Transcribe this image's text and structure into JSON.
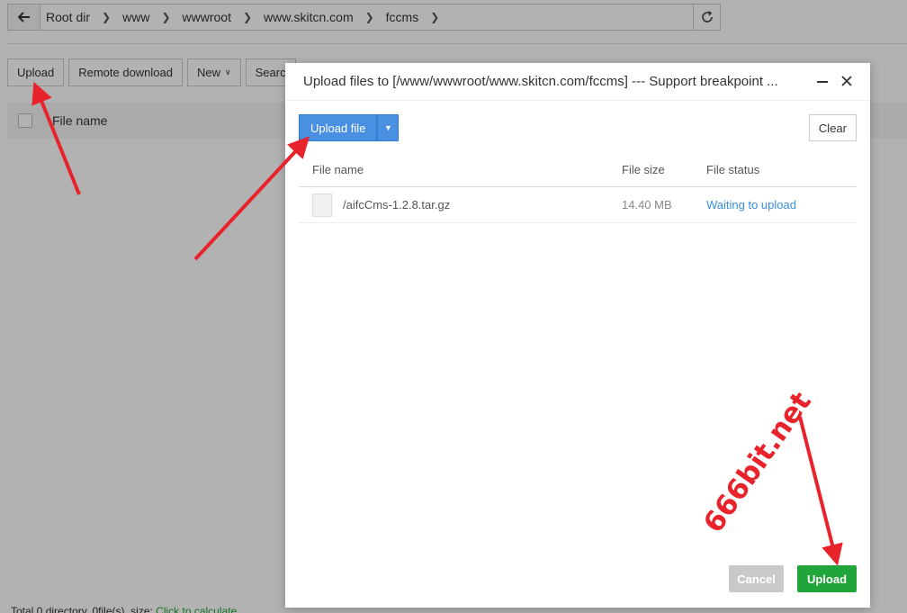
{
  "pathbar": {
    "crumbs": [
      "Root dir",
      "www",
      "wwwroot",
      "www.skitcn.com",
      "fccms"
    ]
  },
  "toolbar": {
    "upload": "Upload",
    "remote_download": "Remote download",
    "new": "New",
    "search": "Searc"
  },
  "table": {
    "col_filename": "File name"
  },
  "footer": {
    "summary": "Total 0 directory, 0file(s), size:",
    "calc_link": "Click to calculate"
  },
  "modal": {
    "title": "Upload files to [/www/wwwroot/www.skitcn.com/fccms] --- Support breakpoint ...",
    "upload_file": "Upload file",
    "clear": "Clear",
    "headers": {
      "name": "File name",
      "size": "File size",
      "status": "File status"
    },
    "files": [
      {
        "name": "/aifcCms-1.2.8.tar.gz",
        "size": "14.40 MB",
        "status": "Waiting to upload"
      }
    ],
    "cancel": "Cancel",
    "upload": "Upload"
  },
  "watermark": "666bit.net",
  "colors": {
    "accent_blue": "#4a90e2",
    "green": "#20a53a",
    "arrow_red": "#e8232b"
  }
}
